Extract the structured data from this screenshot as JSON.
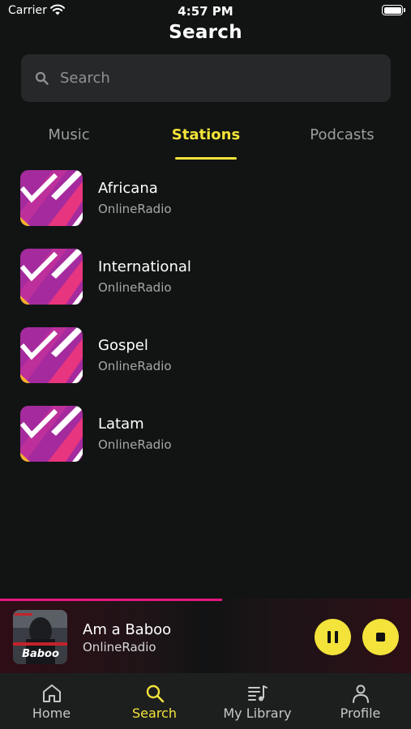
{
  "status_bar": {
    "carrier": "Carrier",
    "time": "4:57 PM"
  },
  "header": {
    "title": "Search"
  },
  "search": {
    "placeholder": "Search",
    "value": ""
  },
  "tabs": [
    {
      "label": "Music",
      "active": false
    },
    {
      "label": "Stations",
      "active": true
    },
    {
      "label": "Podcasts",
      "active": false
    }
  ],
  "stations": [
    {
      "title": "Africana",
      "subtitle": "OnlineRadio"
    },
    {
      "title": "International",
      "subtitle": "OnlineRadio"
    },
    {
      "title": "Gospel",
      "subtitle": "OnlineRadio"
    },
    {
      "title": "Latam",
      "subtitle": "OnlineRadio"
    }
  ],
  "now_playing": {
    "title": "Am a Baboo",
    "subtitle": "OnlineRadio",
    "progress": 0.54,
    "album_art_text": "Baboo"
  },
  "bottom_nav": [
    {
      "label": "Home",
      "icon": "home-icon",
      "active": false
    },
    {
      "label": "Search",
      "icon": "search-icon",
      "active": true
    },
    {
      "label": "My Library",
      "icon": "library-icon",
      "active": false
    },
    {
      "label": "Profile",
      "icon": "profile-icon",
      "active": false
    }
  ],
  "colors": {
    "accent": "#f3e33a",
    "background": "#121413",
    "progress": "#e5177f",
    "thumb_purple": "#a42a9e",
    "thumb_pink": "#e8357f"
  }
}
